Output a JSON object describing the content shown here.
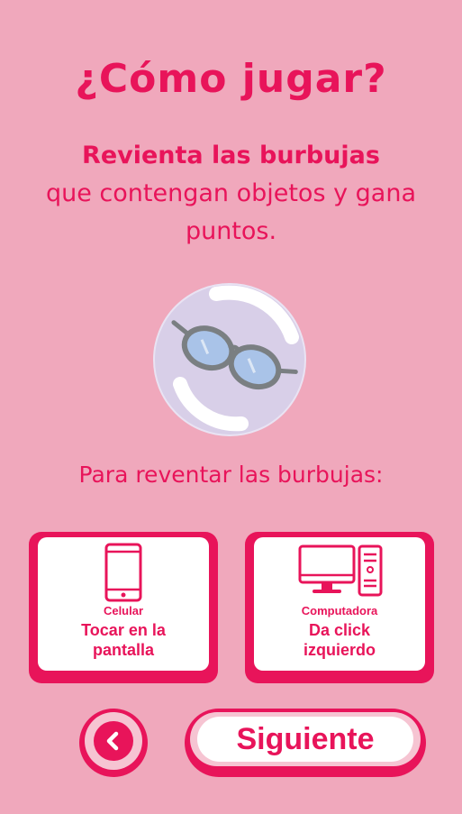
{
  "screen": {
    "title": "¿Cómo jugar?",
    "intro_strong": "Revienta las burbujas",
    "intro_rest": "que contengan objetos y gana puntos.",
    "subtitle": "Para reventar las burbujas:"
  },
  "illustration": {
    "icon": "glasses-in-bubble"
  },
  "cards": [
    {
      "icon": "phone-icon",
      "label": "Celular",
      "action_line1": "Tocar en la",
      "action_line2": "pantalla"
    },
    {
      "icon": "computer-icon",
      "label": "Computadora",
      "action_line1": "Da click",
      "action_line2": "izquierdo"
    }
  ],
  "buttons": {
    "back_icon": "chevron-left-icon",
    "next_label": "Siguiente"
  },
  "colors": {
    "background": "#f0a8bc",
    "accent": "#e8145a",
    "button_ring": "#f6c4d2",
    "card_face": "#ffffff"
  }
}
